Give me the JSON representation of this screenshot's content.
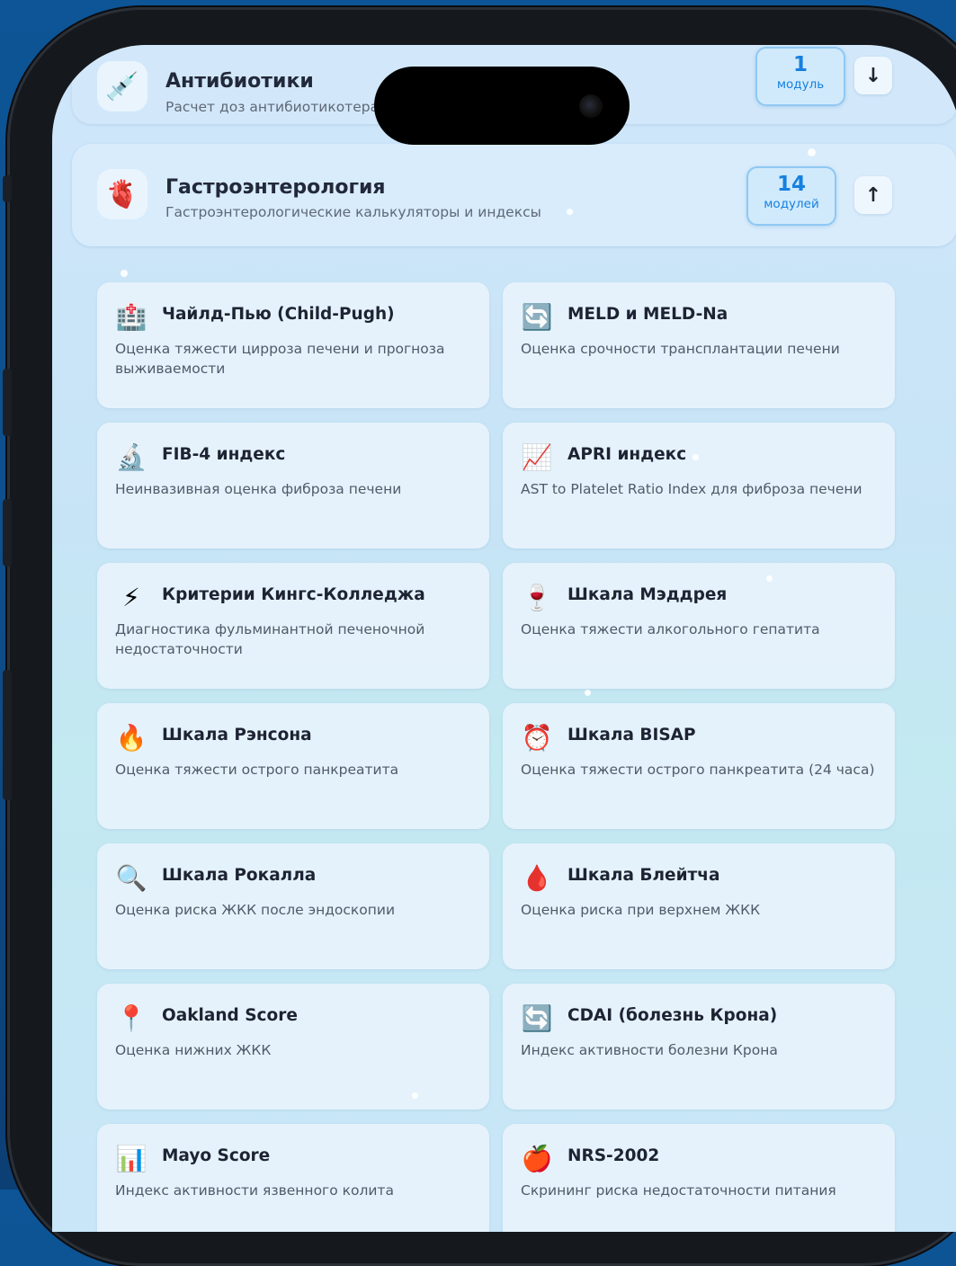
{
  "categories": [
    {
      "icon": "syringe-icon",
      "emoji": "💉",
      "title": "Антибиотики",
      "subtitle": "Расчет доз антибиотикотера",
      "count": "1",
      "count_label": "модуль",
      "arrow": "↓"
    },
    {
      "icon": "heart-icon",
      "emoji": "🫀",
      "title": "Гастроэнтерология",
      "subtitle": "Гастроэнтерологические калькуляторы и индексы",
      "count": "14",
      "count_label": "модулей",
      "arrow": "↑"
    }
  ],
  "modules": [
    {
      "icon": "hospital-icon",
      "emoji": "🏥",
      "title": "Чайлд-Пью (Child-Pugh)",
      "desc": "Оценка тяжести цирроза печени и прогноза выживаемости"
    },
    {
      "icon": "refresh-icon",
      "emoji": "🔄",
      "title": "MELD и MELD-Na",
      "desc": "Оценка срочности трансплантации печени"
    },
    {
      "icon": "microscope-icon",
      "emoji": "🔬",
      "title": "FIB-4 индекс",
      "desc": "Неинвазивная оценка фиброза печени"
    },
    {
      "icon": "chart-increasing-icon",
      "emoji": "📈",
      "title": "APRI индекс",
      "desc": "AST to Platelet Ratio Index для фиброза печени"
    },
    {
      "icon": "lightning-icon",
      "emoji": "⚡",
      "title": "Критерии Кингс-Колледжа",
      "desc": "Диагностика фульминантной печеночной недостаточности"
    },
    {
      "icon": "wine-glass-icon",
      "emoji": "🍷",
      "title": "Шкала Мэддрея",
      "desc": "Оценка тяжести алкогольного гепатита"
    },
    {
      "icon": "fire-icon",
      "emoji": "🔥",
      "title": "Шкала Рэнсона",
      "desc": "Оценка тяжести острого панкреатита"
    },
    {
      "icon": "alarm-clock-icon",
      "emoji": "⏰",
      "title": "Шкала BISAP",
      "desc": "Оценка тяжести острого панкреатита (24 часа)"
    },
    {
      "icon": "magnifier-icon",
      "emoji": "🔍",
      "title": "Шкала Рокалла",
      "desc": "Оценка риска ЖКК после эндоскопии"
    },
    {
      "icon": "blood-drop-icon",
      "emoji": "🩸",
      "title": "Шкала Блейтча",
      "desc": "Оценка риска при верхнем ЖКК"
    },
    {
      "icon": "pin-icon",
      "emoji": "📍",
      "title": "Oakland Score",
      "desc": "Оценка нижних ЖКК"
    },
    {
      "icon": "refresh-icon",
      "emoji": "🔄",
      "title": "CDAI (болезнь Крона)",
      "desc": "Индекс активности болезни Крона"
    },
    {
      "icon": "bar-chart-icon",
      "emoji": "📊",
      "title": "Mayo Score",
      "desc": "Индекс активности язвенного колита"
    },
    {
      "icon": "apple-icon",
      "emoji": "🍎",
      "title": "NRS-2002",
      "desc": "Скрининг риска недостаточности питания"
    }
  ]
}
